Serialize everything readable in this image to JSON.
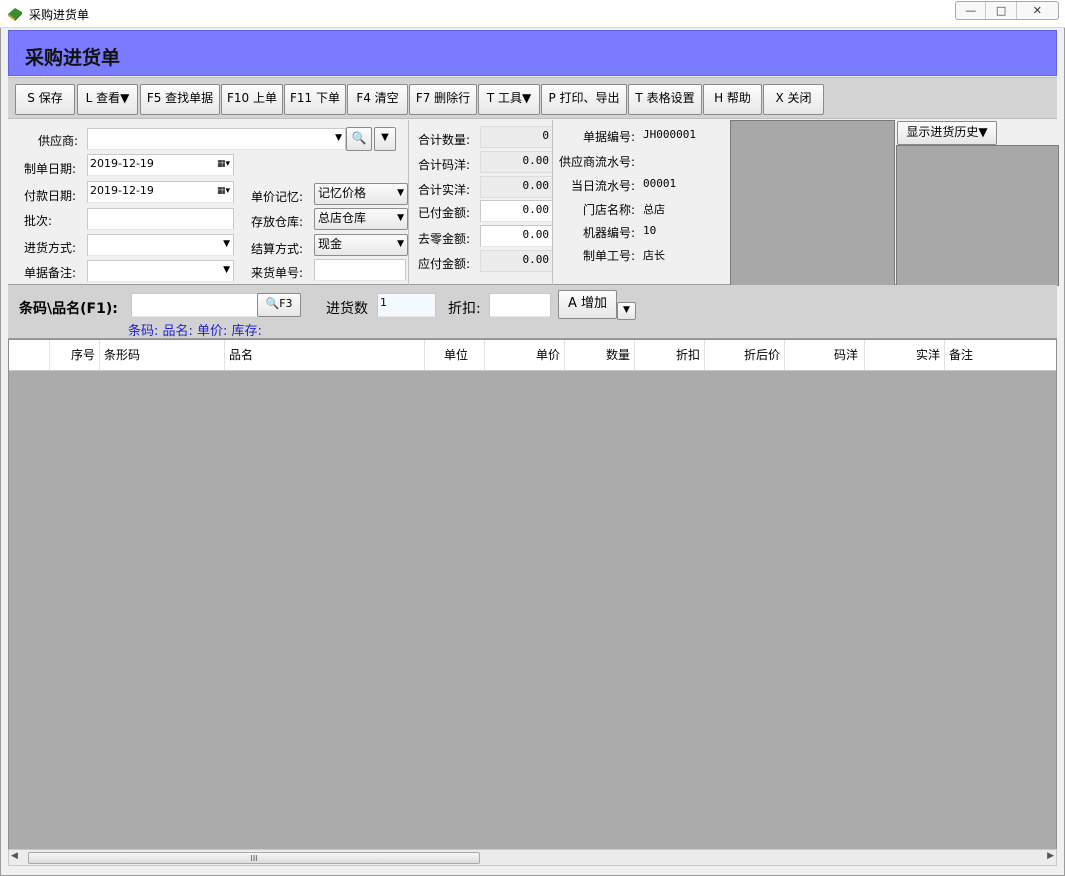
{
  "window": {
    "title": "采购进货单",
    "controls": [
      "—",
      "□",
      "✕"
    ]
  },
  "banner": {
    "title": "采购进货单"
  },
  "toolbar": {
    "buttons": [
      "S 保存",
      "L 查看▼",
      "F5 查找单据",
      "F10 上单",
      "F11 下单",
      "F4 清空",
      "F7 删除行",
      "T 工具▼",
      "P 打印、导出",
      "T 表格设置",
      "H 帮助",
      "X 关闭"
    ]
  },
  "form": {
    "supplier_label": "供应商:",
    "supplier_value": "",
    "create_date_label": "制单日期:",
    "create_date_value": "2019-12-19",
    "pay_date_label": "付款日期:",
    "pay_date_value": "2019-12-19",
    "batch_label": "批次:",
    "batch_value": "",
    "purchase_method_label": "进货方式:",
    "purchase_method_value": "",
    "remark_label": "单据备注:",
    "remark_value": "",
    "price_memory_label": "单价记忆:",
    "price_memory_value": "记忆价格",
    "warehouse_label": "存放仓库:",
    "warehouse_value": "总店仓库",
    "settle_label": "结算方式:",
    "settle_value": "现金",
    "incoming_no_label": "来货单号:",
    "incoming_no_value": ""
  },
  "totals": [
    {
      "label": "合计数量:",
      "value": "0",
      "readonly": true
    },
    {
      "label": "合计码洋:",
      "value": "0.00",
      "readonly": true
    },
    {
      "label": "合计实洋:",
      "value": "0.00",
      "readonly": true
    },
    {
      "label": "已付金额:",
      "value": "0.00",
      "readonly": false
    },
    {
      "label": "去零金额:",
      "value": "0.00",
      "readonly": false
    },
    {
      "label": "应付金额:",
      "value": "0.00",
      "readonly": true
    }
  ],
  "info": [
    {
      "label": "单据编号:",
      "value": "JH000001"
    },
    {
      "label": "供应商流水号:",
      "value": ""
    },
    {
      "label": "当日流水号:",
      "value": "00001"
    },
    {
      "label": "门店名称:",
      "value": "总店"
    },
    {
      "label": "机器编号:",
      "value": "10"
    },
    {
      "label": "制单工号:",
      "value": "店长"
    }
  ],
  "history_button": "显示进货历史▼",
  "scan": {
    "barcode_label": "条码\\品名(F1):",
    "barcode_value": "",
    "search_btn": "F3",
    "qty_label": "进货数",
    "qty_value": "1",
    "discount_label": "折扣:",
    "discount_value": "",
    "add_btn": "A 增加",
    "hint": "条码:  品名:  单价:  库存:"
  },
  "grid": {
    "columns": [
      "序号",
      "条形码",
      "品名",
      "单位",
      "单价",
      "数量",
      "折扣",
      "折后价",
      "码洋",
      "实洋",
      "备注"
    ]
  },
  "scrollbar": {
    "thumb_grip": "III"
  }
}
